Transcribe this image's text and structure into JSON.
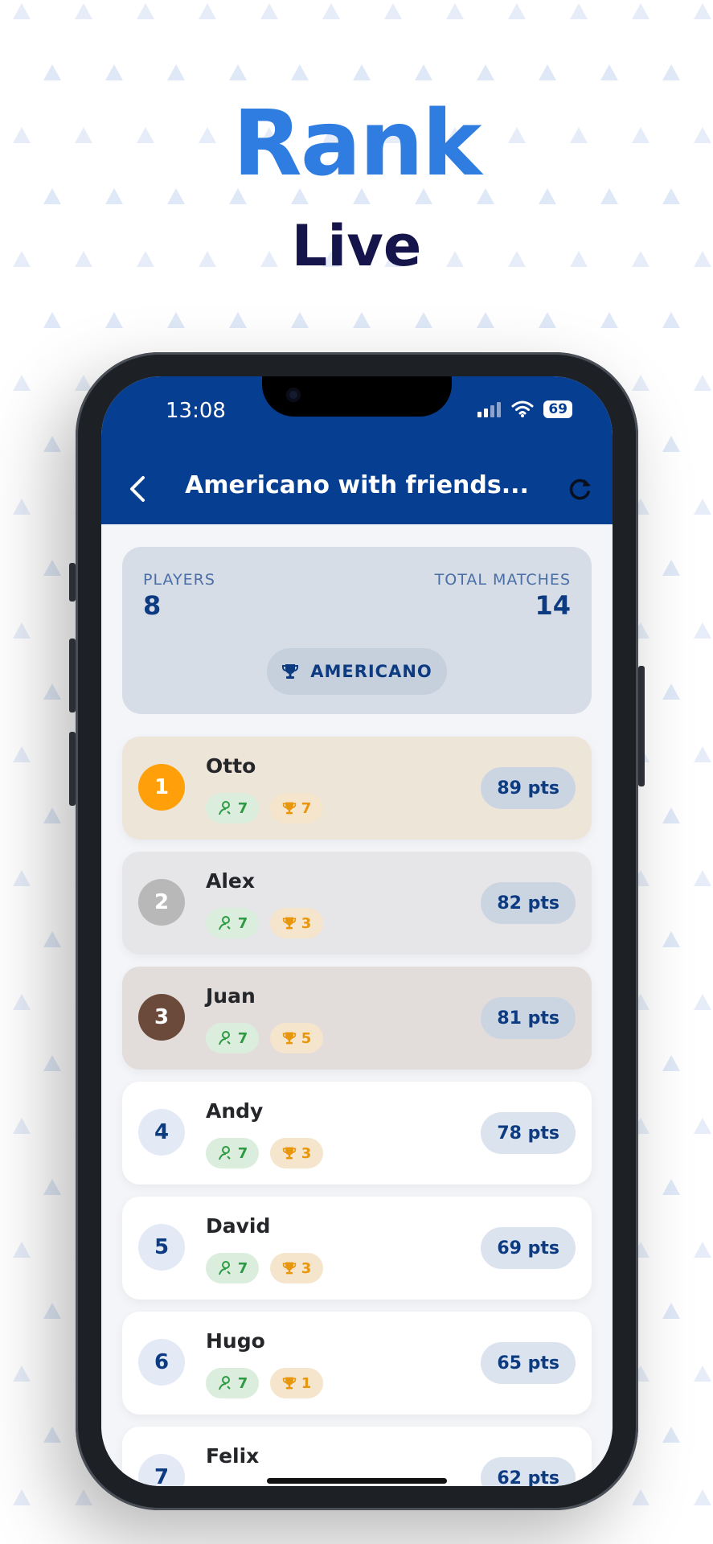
{
  "hero": {
    "title": "Rank",
    "subtitle": "Live"
  },
  "status_bar": {
    "time": "13:08",
    "battery": "69"
  },
  "app_bar": {
    "title": "Americano with friends..."
  },
  "summary": {
    "players_label": "PLAYERS",
    "players_value": "8",
    "matches_label": "TOTAL MATCHES",
    "matches_value": "14",
    "mode": "AMERICANO"
  },
  "players": [
    {
      "rank": "1",
      "name": "Otto",
      "matches": "7",
      "wins": "7",
      "points": "89 pts"
    },
    {
      "rank": "2",
      "name": "Alex",
      "matches": "7",
      "wins": "3",
      "points": "82 pts"
    },
    {
      "rank": "3",
      "name": "Juan",
      "matches": "7",
      "wins": "5",
      "points": "81 pts"
    },
    {
      "rank": "4",
      "name": "Andy",
      "matches": "7",
      "wins": "3",
      "points": "78 pts"
    },
    {
      "rank": "5",
      "name": "David",
      "matches": "7",
      "wins": "3",
      "points": "69 pts"
    },
    {
      "rank": "6",
      "name": "Hugo",
      "matches": "7",
      "wins": "1",
      "points": "65 pts"
    },
    {
      "rank": "7",
      "name": "Felix",
      "points": "62 pts"
    }
  ],
  "colors": {
    "brand_blue": "#063e92",
    "headline_blue": "#2f7de1",
    "gold": "#ff9f0a",
    "silver": "#b8b8b8",
    "bronze": "#6b4a3c",
    "matches_green": "#2e9a43",
    "wins_orange": "#e8960c"
  },
  "icons": [
    "back-chevron-icon",
    "refresh-icon",
    "trophy-icon",
    "person-icon",
    "signal-icon",
    "wifi-icon",
    "battery-icon"
  ]
}
